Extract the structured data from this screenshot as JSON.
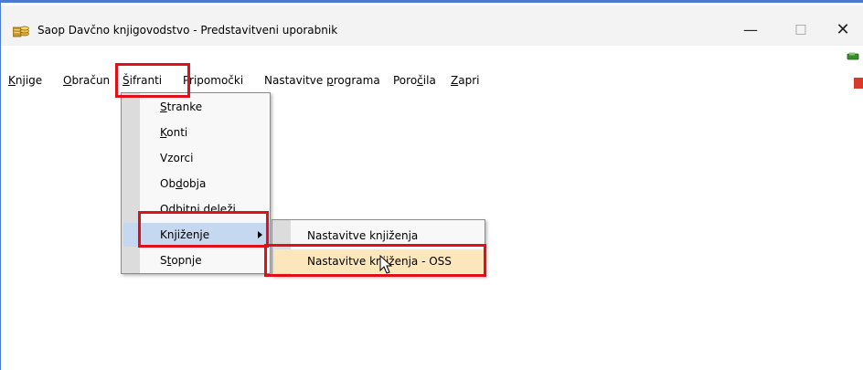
{
  "window": {
    "title": "Saop Davčno knjigovodstvo - Predstavitveni uporabnik",
    "controls": {
      "minimize": "—",
      "maximize": "□",
      "close": "✕"
    }
  },
  "menubar": {
    "items": [
      {
        "label": "Knjige",
        "mnemonic": "K"
      },
      {
        "label": "Obračun",
        "mnemonic": "O"
      },
      {
        "label": "Šifranti",
        "mnemonic": "Š"
      },
      {
        "label": "Pripomočki",
        "mnemonic": "P"
      },
      {
        "label": "Nastavitve programa",
        "mnemonic": "p"
      },
      {
        "label": "Poročila",
        "mnemonic": "č"
      },
      {
        "label": "Zapri",
        "mnemonic": "Z"
      }
    ]
  },
  "sifranti_menu": {
    "items": [
      {
        "label": "Stranke",
        "mnemonic": "S"
      },
      {
        "label": "Konti",
        "mnemonic": "K"
      },
      {
        "label": "Vzorci",
        "mnemonic": ""
      },
      {
        "label": "Obdobja",
        "mnemonic": "d"
      },
      {
        "label": "Odbitni deleži",
        "mnemonic": ""
      },
      {
        "label": "Knjiženje",
        "mnemonic": "",
        "has_submenu": true,
        "highlighted": true
      },
      {
        "label": "Stopnje",
        "mnemonic": "t"
      }
    ]
  },
  "knjizenje_submenu": {
    "items": [
      {
        "label": "Nastavitve knjiženja"
      },
      {
        "label": "Nastavitve knjiženja - OSS",
        "hovered": true
      }
    ]
  },
  "colors": {
    "highlight": "#c5d8f0",
    "hover": "#fce7bd",
    "annotation_red": "#e0101a"
  },
  "icons": {
    "app": "ledger-coins-icon",
    "cursor": "arrow-cursor-icon"
  }
}
